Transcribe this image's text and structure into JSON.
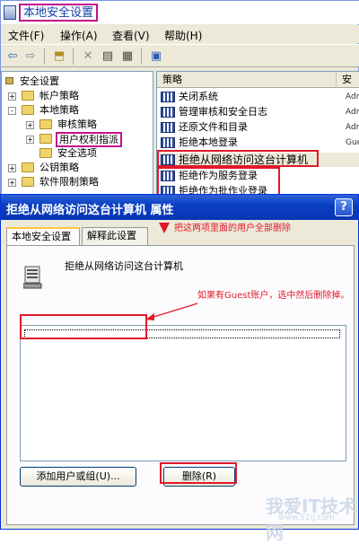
{
  "mmc": {
    "title": "本地安全设置",
    "menu": [
      "文件(F)",
      "操作(A)",
      "查看(V)",
      "帮助(H)"
    ],
    "tree": [
      {
        "label": "安全设置",
        "level": 0,
        "expander": "",
        "icon": "shield-icon"
      },
      {
        "label": "帐户策略",
        "level": 1,
        "expander": "+",
        "icon": "folder-icon"
      },
      {
        "label": "本地策略",
        "level": 1,
        "expander": "-",
        "icon": "folder-icon"
      },
      {
        "label": "审核策略",
        "level": 2,
        "expander": "+",
        "icon": "folder-icon"
      },
      {
        "label": "用户权利指派",
        "level": 2,
        "expander": "+",
        "icon": "folder-icon"
      },
      {
        "label": "安全选项",
        "level": 2,
        "expander": "",
        "icon": "folder-icon"
      },
      {
        "label": "公钥策略",
        "level": 1,
        "expander": "+",
        "icon": "folder-icon"
      },
      {
        "label": "软件限制策略",
        "level": 1,
        "expander": "+",
        "icon": "folder-icon"
      }
    ],
    "columns": [
      "策略",
      "安"
    ],
    "policies": [
      {
        "name": "关闭系统",
        "value": "Adm"
      },
      {
        "name": "管理审核和安全日志",
        "value": "Adm"
      },
      {
        "name": "还原文件和目录",
        "value": "Adm"
      },
      {
        "name": "拒绝本地登录",
        "value": "Gue"
      },
      {
        "name": "拒绝从网络访问这台计算机",
        "value": ""
      },
      {
        "name": "拒绝作为服务登录",
        "value": ""
      },
      {
        "name": "拒绝作为批作业登录",
        "value": ""
      }
    ]
  },
  "dialog": {
    "title": "拒绝从网络访问这台计算机 属性",
    "help": "?",
    "tabs": [
      "本地安全设置",
      "解释此设置"
    ],
    "policy_name": "拒绝从网络访问这台计算机",
    "add_button": "添加用户或组(U)...",
    "remove_button": "删除(R)"
  },
  "annotations": {
    "top": "把这两项里面的用户全部删除",
    "middle": "如果有Guest账户，选中然后删除掉。"
  },
  "watermark": {
    "text": "我爱IT技术网",
    "url": "www.52ij.com"
  },
  "colors": {
    "annotation": "#e0192a",
    "title_bar": "#0a3fc3",
    "highlight": "#c2128c"
  }
}
